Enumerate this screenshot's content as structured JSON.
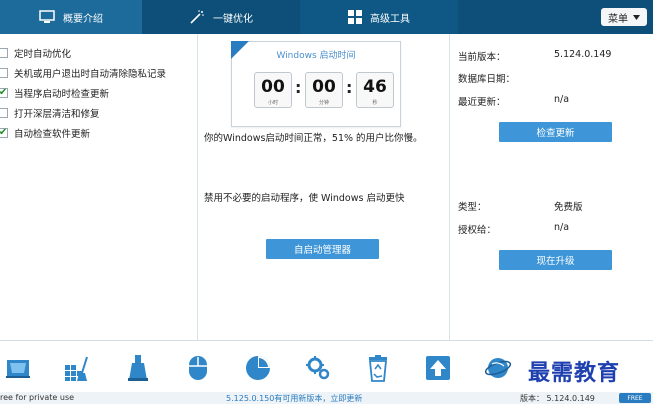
{
  "tabs": [
    {
      "label": "概要介绍",
      "icon": "monitor-icon",
      "active": true
    },
    {
      "label": "一键优化",
      "icon": "magic-wand-icon",
      "active": false
    },
    {
      "label": "高级工具",
      "icon": "grid-icon",
      "active": false
    }
  ],
  "menu": {
    "label": "菜单"
  },
  "options": [
    {
      "label": "定时自动优化",
      "checked": false
    },
    {
      "label": "关机或用户退出时自动清除隐私记录",
      "checked": false
    },
    {
      "label": "当程序启动时检查更新",
      "checked": true
    },
    {
      "label": "打开深层清洁和修复",
      "checked": false
    },
    {
      "label": "自动检查软件更新",
      "checked": true
    }
  ],
  "boot": {
    "title": "Windows 启动时间",
    "hours": "00",
    "minutes": "00",
    "seconds": "46",
    "hours_unit": "小时",
    "minutes_unit": "分钟",
    "seconds_unit": "秒",
    "message": "你的Windows启动时间正常，51% 的用户比你慢。",
    "tip": "禁用不必要的启动程序，使 Windows 启动更快",
    "manager_button": "自启动管理器"
  },
  "info": {
    "current_version_label": "当前版本：",
    "current_version": "5.124.0.149",
    "db_date_label": "数据库日期：",
    "db_date": "",
    "last_update_label": "最近更新：",
    "last_update": "n/a",
    "check_update_button": "检查更新",
    "type_label": "类型：",
    "type": "免费版",
    "license_label": "授权给：",
    "license": "n/a",
    "upgrade_button": "现在升级"
  },
  "toolbar": [
    {
      "icon": "disk-cleaner-icon"
    },
    {
      "icon": "registry-cleaner-icon"
    },
    {
      "icon": "disk-wipe-icon"
    },
    {
      "icon": "mouse-icon"
    },
    {
      "icon": "disk-analyzer-icon"
    },
    {
      "icon": "settings-icon"
    },
    {
      "icon": "recycle-bin-icon"
    },
    {
      "icon": "upload-icon"
    },
    {
      "icon": "internet-icon"
    }
  ],
  "status": {
    "left": "ree for private use",
    "center": "5.125.0.150有可用新版本，立即更新",
    "right_label": "版本：",
    "right_version": "5.124.0.149",
    "badge": "FREE"
  },
  "watermark": "最需教育",
  "colors": {
    "topbar": "#0d4f78",
    "tab_active": "#1c6b9b",
    "button": "#3e96d8",
    "accent": "#2a7cc0"
  }
}
